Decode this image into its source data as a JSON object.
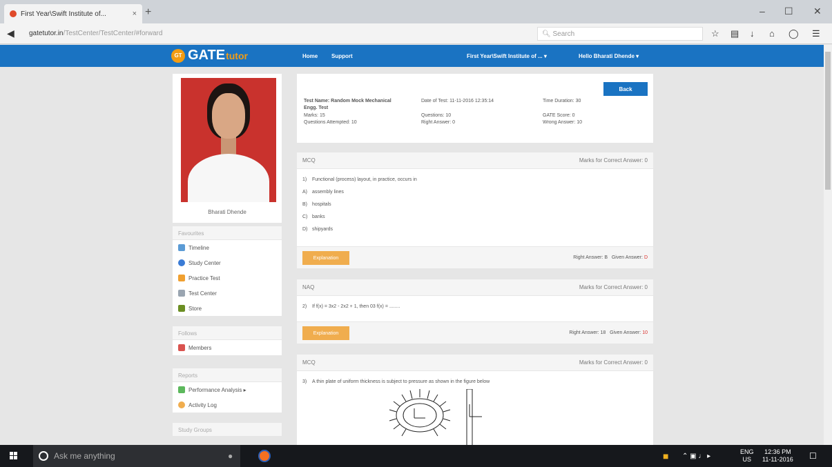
{
  "browser": {
    "tab_title": "First Year\\Swift Institute of...",
    "tab_close": "×",
    "new_tab": "+",
    "url_domain": "gatetutor.in",
    "url_path": "/TestCenter/TestCenter/#forward",
    "search_placeholder": "Search",
    "win_minimize": "–",
    "win_maximize": "☐",
    "win_close": "✕"
  },
  "site": {
    "logo_badge": "GT",
    "logo_gate": "GATE",
    "logo_tutor": "tutor",
    "nav_home": "Home",
    "nav_support": "Support",
    "institute_menu": "First Year\\Swift Institute of ... ▾",
    "user_menu": "Hello Bharati Dhende ▾"
  },
  "profile": {
    "name": "Bharati Dhende"
  },
  "sidebar": {
    "favourites_header": "Favourites",
    "favourites": [
      {
        "label": "Timeline",
        "color": "#5b9bd5"
      },
      {
        "label": "Study Center",
        "color": "#3a7bd5"
      },
      {
        "label": "Practice Test",
        "color": "#f0a030"
      },
      {
        "label": "Test Center",
        "color": "#9aa5b1"
      },
      {
        "label": "Store",
        "color": "#6b8e23"
      }
    ],
    "followers_header": "Follows",
    "followers": [
      {
        "label": "Members",
        "color": "#d9534f"
      }
    ],
    "reports_header": "Reports",
    "reports": [
      {
        "label": "Performance Analysis ▸",
        "color": "#5cb85c"
      },
      {
        "label": "Activity Log",
        "color": "#f0ad4e"
      }
    ],
    "groups_header": "Study Groups"
  },
  "summary": {
    "back": "Back",
    "test_name": "Test Name: Random Mock Mechanical Engg. Test",
    "marks": "Marks: 15",
    "attempted": "Questions Attempted: 10",
    "date": "Date of Test: 11-11-2016 12:35:14",
    "questions": "Questions: 10",
    "right": "Right Answer: 0",
    "duration": "Time Duration: 30",
    "gate_score": "GATE Score: 0",
    "wrong": "Wrong Answer: 10"
  },
  "questions": [
    {
      "type": "MCQ",
      "marks": "Marks for Correct Answer: 0",
      "number": "1)",
      "text": "Functional (process) layout, in practice, occurs in",
      "options": [
        {
          "key": "A)",
          "text": "assembly lines"
        },
        {
          "key": "B)",
          "text": "hospitals"
        },
        {
          "key": "C)",
          "text": "banks"
        },
        {
          "key": "D)",
          "text": "shipyards"
        }
      ],
      "explanation": "Explanation",
      "right_label": "Right Answer: B",
      "given_label": "Given Answer:",
      "given_value": "D"
    },
    {
      "type": "NAQ",
      "marks": "Marks for Correct Answer: 0",
      "number": "2)",
      "text": "If f(x) = 3x2 - 2x2 + 1, then 03 f(x) = ........",
      "explanation": "Explanation",
      "right_label": "Right Answer: 18",
      "given_label": "Given Answer:",
      "given_value": "10"
    },
    {
      "type": "MCQ",
      "marks": "Marks for Correct Answer: 0",
      "number": "3)",
      "text": "A thin plate of uniform thickness is subject to pressure as shown in the figure below"
    }
  ],
  "taskbar": {
    "search_placeholder": "Ask me anything",
    "lang": "ENG",
    "region": "US",
    "time": "12:36 PM",
    "date": "11-11-2016"
  }
}
